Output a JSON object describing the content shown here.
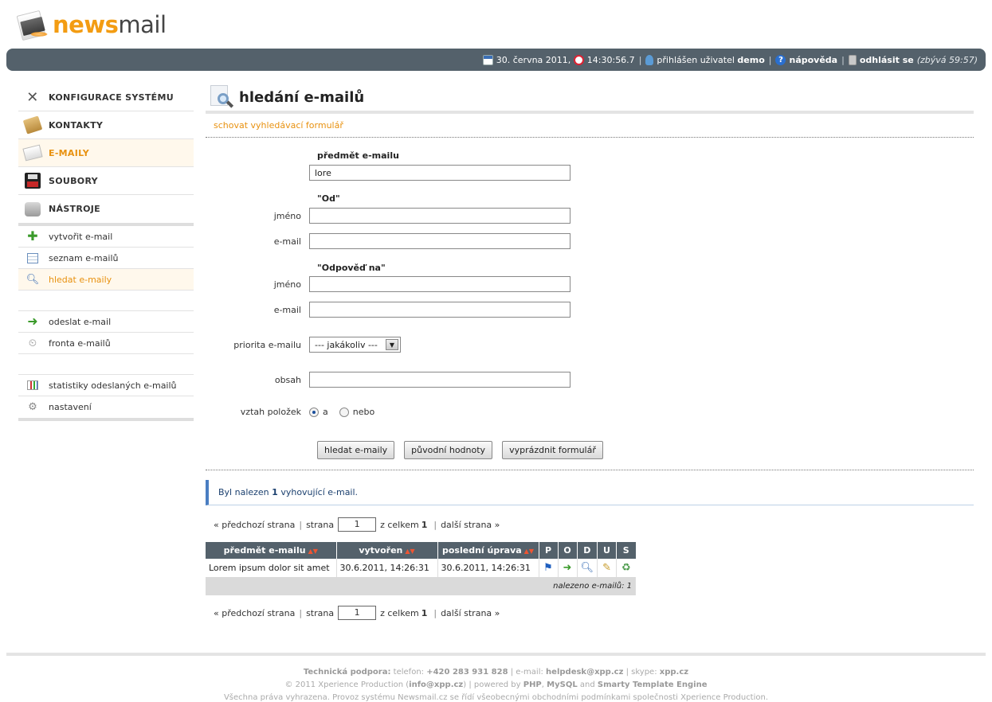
{
  "logo": {
    "part1": "news",
    "part2": "mail"
  },
  "topbar": {
    "date": "30. června 2011,",
    "time": "14:30:56.7",
    "logged_prefix": "přihlášen uživatel",
    "user": "demo",
    "help": "nápověda",
    "logout": "odhlásit se",
    "remaining": "(zbývá 59:57)",
    "sep": "|"
  },
  "sidebar": {
    "main": [
      {
        "label": "KONFIGURACE SYSTÉMU"
      },
      {
        "label": "KONTAKTY"
      },
      {
        "label": "E-MAILY"
      },
      {
        "label": "SOUBORY"
      },
      {
        "label": "NÁSTROJE"
      }
    ],
    "sub1": [
      {
        "label": "vytvořit e-mail"
      },
      {
        "label": "seznam e-mailů"
      },
      {
        "label": "hledat e-maily"
      }
    ],
    "sub2": [
      {
        "label": "odeslat e-mail"
      },
      {
        "label": "fronta e-mailů"
      }
    ],
    "sub3": [
      {
        "label": "statistiky odeslaných e-mailů"
      },
      {
        "label": "nastavení"
      }
    ]
  },
  "page": {
    "title": "hledání e-mailů",
    "hide_link": "schovat vyhledávací formulář"
  },
  "form": {
    "subject_label": "předmět e-mailu",
    "subject_value": "lore",
    "from_group": "\"Od\"",
    "reply_group": "\"Odpověď na\"",
    "name_label": "jméno",
    "email_label": "e-mail",
    "priority_label": "priorita e-mailu",
    "priority_value": "--- jakákoliv ---",
    "content_label": "obsah",
    "relation_label": "vztah položek",
    "relation_and": "a",
    "relation_or": "nebo",
    "btn_search": "hledat e-maily",
    "btn_reset": "původní hodnoty",
    "btn_clear": "vyprázdnit formulář"
  },
  "result": {
    "msg_prefix": "Byl nalezen",
    "count": "1",
    "msg_suffix": "vyhovující e-mail."
  },
  "pager": {
    "prev": "« předchozí strana",
    "sep": "|",
    "page_label": "strana",
    "page_value": "1",
    "total_label": "z celkem",
    "total": "1",
    "next": "další strana »"
  },
  "table": {
    "headers": [
      "předmět e-mailu",
      "vytvořen",
      "poslední úprava",
      "P",
      "O",
      "D",
      "U",
      "S"
    ],
    "rows": [
      {
        "subject": "Lorem ipsum dolor sit amet",
        "created": "30.6.2011, 14:26:31",
        "modified": "30.6.2011, 14:26:31"
      }
    ],
    "footer": "nalezeno e-mailů: 1"
  },
  "footer": {
    "line1": {
      "support": "Technická podpora:",
      "phone_label": "telefon:",
      "phone": "+420 283 931 828",
      "email_label": "e-mail:",
      "email": "helpdesk@xpp.cz",
      "skype_label": "skype:",
      "skype": "xpp.cz",
      "sep": "|"
    },
    "line2": {
      "copy": "© 2011 Xperience Production (",
      "email": "info@xpp.cz",
      "close": ")",
      "powered": "powered by",
      "php": "PHP",
      "comma": ",",
      "mysql": "MySQL",
      "and": "and",
      "smarty": "Smarty Template Engine",
      "sep": "|"
    },
    "line3": "Všechna práva vyhrazena. Provoz systému Newsmail.cz se řídí všeobecnými obchodními podmínkami společnosti Xperience Production."
  }
}
